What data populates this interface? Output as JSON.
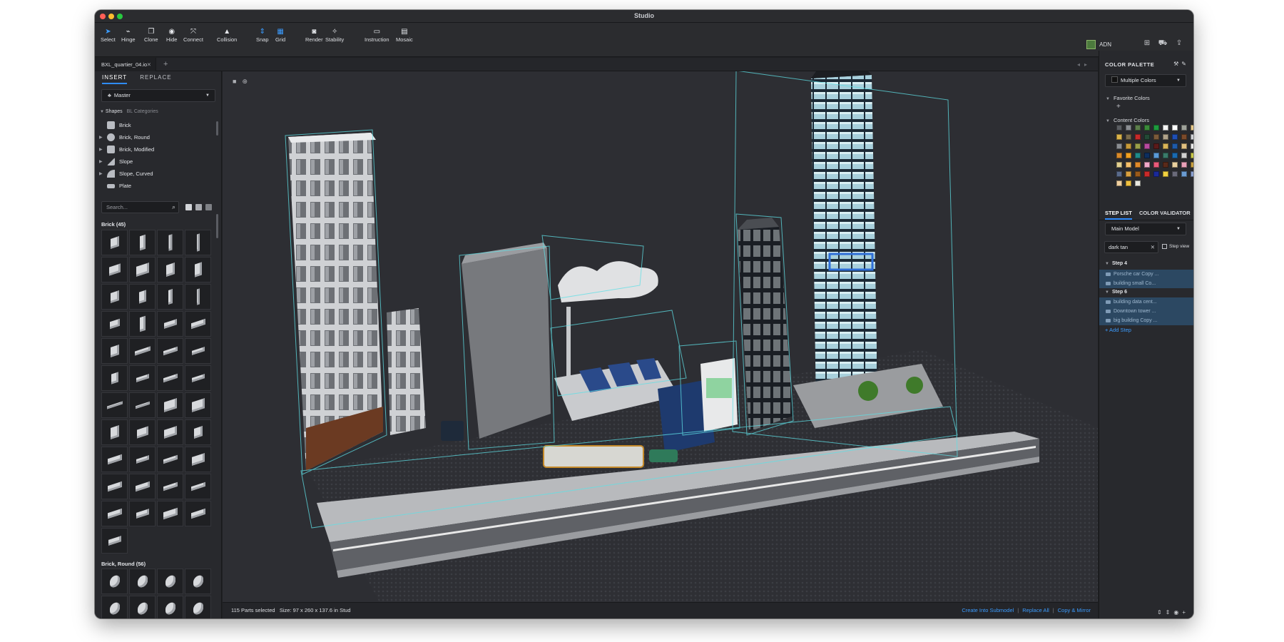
{
  "app": {
    "title": "Studio"
  },
  "toolbar": {
    "tools": [
      {
        "label": "Select",
        "icon": "cursor-icon"
      },
      {
        "label": "Hinge",
        "icon": "hinge-icon"
      },
      {
        "label": "Clone",
        "icon": "clone-icon"
      },
      {
        "label": "Hide",
        "icon": "hide-icon"
      },
      {
        "label": "Connect",
        "icon": "connect-icon"
      },
      {
        "label": "Collision",
        "icon": "collision-icon"
      },
      {
        "label": "Snap",
        "icon": "snap-icon"
      },
      {
        "label": "Grid",
        "icon": "grid-icon"
      },
      {
        "label": "Render",
        "icon": "camera-icon"
      },
      {
        "label": "Stability",
        "icon": "stability-icon"
      },
      {
        "label": "Instruction",
        "icon": "instruction-icon"
      },
      {
        "label": "Mosaic",
        "icon": "mosaic-icon"
      }
    ],
    "user_name": "ADN"
  },
  "tabs": {
    "file_tab": "BXL_quartier_04.io"
  },
  "left_panel": {
    "tab_insert": "INSERT",
    "tab_replace": "REPLACE",
    "palette_select": "Master",
    "section_shapes": "Shapes",
    "section_bl": "BL Categories",
    "shape_list": [
      "Brick",
      "Brick, Round",
      "Brick, Modified",
      "Slope",
      "Slope, Curved",
      "Plate"
    ],
    "search_placeholder": "Search...",
    "group_brick": "Brick (45)",
    "group_brick_round": "Brick, Round (56)"
  },
  "statusbar": {
    "selection": "115 Parts selected",
    "size": "Size: 97 x 260 x 137.6 in Stud",
    "link_create": "Create Into Submodel",
    "link_replace": "Replace All",
    "link_copy": "Copy & Mirror"
  },
  "right_panel": {
    "title": "COLOR PALETTE",
    "color_select": "Multiple Colors",
    "favorite_colors": "Favorite Colors",
    "content_colors": "Content Colors",
    "tab_steplist": "STEP LIST",
    "tab_validator": "COLOR VALIDATOR",
    "model_select": "Main Model",
    "filter_value": "dark tan",
    "step_view_label": "Step view",
    "step4": "Step 4",
    "step4_items": [
      "Porsche car Copy ...",
      "building small Co..."
    ],
    "step6": "Step 6",
    "step6_items": [
      "building data cent...",
      "Downtown tower ...",
      "big building Copy ..."
    ],
    "add_step": "+ Add Step",
    "swatches": [
      "#5a5d62",
      "#8b8e93",
      "#5c7e4c",
      "#3a8a3a",
      "#1e9a3e",
      "#f4f4f4",
      "#ffffff",
      "#9fa29a",
      "#e7c98a",
      "#d9b24a",
      "#7a6b4b",
      "#c52a2a",
      "#234a36",
      "#7b5a3a",
      "#b0a28a",
      "#1f4fb5",
      "#7b4a2a",
      "#cfd1d5",
      "#8a8d92",
      "#c79a3a",
      "#9aa04a",
      "#b84aa0",
      "#5a1a1a",
      "#d9b458",
      "#1f5aa8",
      "#e0c080",
      "#e8e8e8",
      "#d98a2a",
      "#f0a020",
      "#1f8a8a",
      "#0d2e5e",
      "#5a9ad6",
      "#3a7a6a",
      "#1a6ab0",
      "#d0d0d0",
      "#c8c84a",
      "#e2d090",
      "#f5c06a",
      "#e08a2a",
      "#f0a8c8",
      "#e85a7a",
      "#5a2a1a",
      "#e8d0a0",
      "#e8a0b8",
      "#c8a040",
      "#5a6a8a",
      "#d9a040",
      "#9a5a1a",
      "#c82a2a",
      "#1a2a9a",
      "#f0d040",
      "#6a6a7a",
      "#6a9ad0",
      "#8aa0d0",
      "#f0d0a0",
      "#f0c040",
      "#e8e8e0"
    ]
  }
}
